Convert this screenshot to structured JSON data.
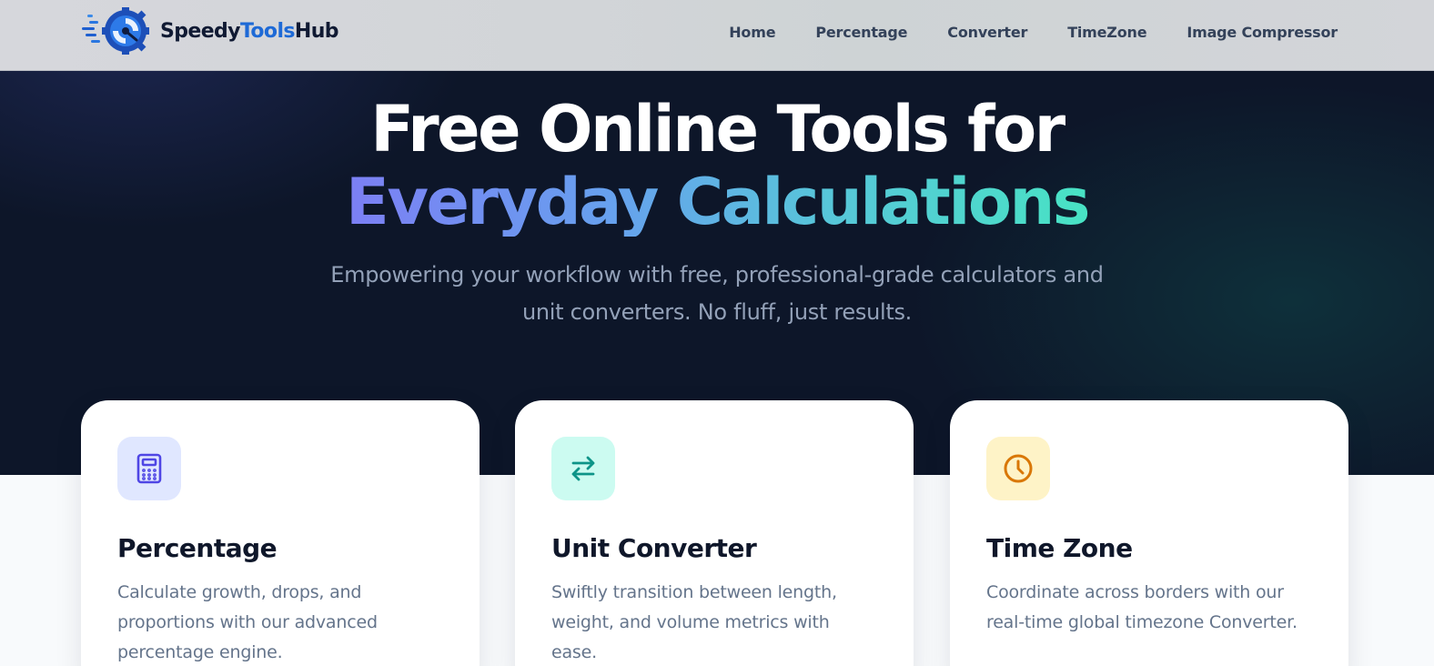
{
  "brand": {
    "name_part1": "Speedy",
    "name_part2": "Tools",
    "name_part3": "Hub"
  },
  "nav": {
    "items": [
      {
        "label": "Home"
      },
      {
        "label": "Percentage"
      },
      {
        "label": "Converter"
      },
      {
        "label": "TimeZone"
      },
      {
        "label": "Image Compressor"
      }
    ]
  },
  "hero": {
    "title_line1": "Free Online Tools for",
    "title_line2": "Everyday Calculations",
    "subtitle_line1": "Empowering your workflow with free, professional-grade calculators and",
    "subtitle_line2": "unit converters. No fluff, just results."
  },
  "cards": [
    {
      "title": "Percentage",
      "description": "Calculate growth, drops, and proportions with our advanced percentage engine.",
      "icon": "calculator-icon",
      "icon_bg": "#e0e7ff",
      "icon_color": "#4f46e5"
    },
    {
      "title": "Unit Converter",
      "description": "Swiftly transition between length, weight, and volume metrics with ease.",
      "icon": "swap-arrows-icon",
      "icon_bg": "#ccfbf1",
      "icon_color": "#0d9488"
    },
    {
      "title": "Time Zone",
      "description": "Coordinate across borders with our real-time global timezone Converter.",
      "icon": "clock-icon",
      "icon_bg": "#fef3c7",
      "icon_color": "#d97706"
    }
  ],
  "colors": {
    "hero_bg": "#0d1629",
    "brand_accent": "#1e6ad6",
    "gradient_start": "#7c7ff4",
    "gradient_end": "#48e3c4"
  }
}
